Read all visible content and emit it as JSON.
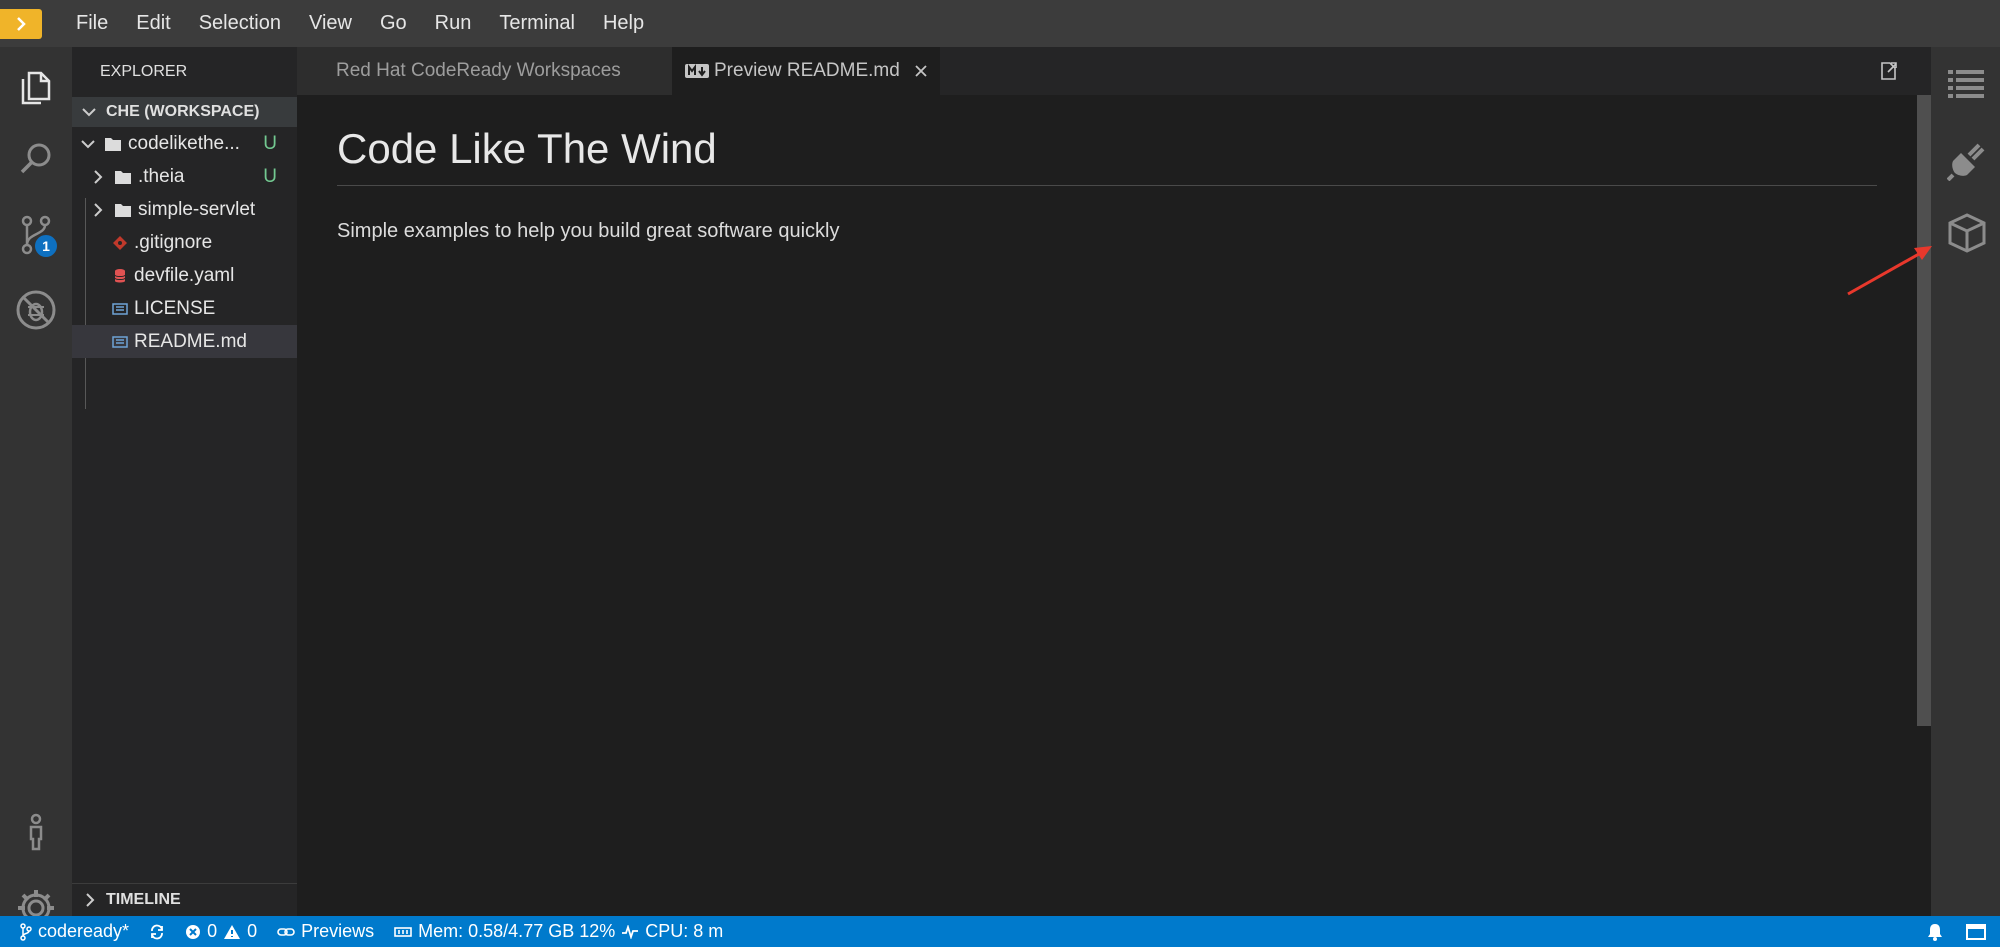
{
  "menu": {
    "items": [
      "File",
      "Edit",
      "Selection",
      "View",
      "Go",
      "Run",
      "Terminal",
      "Help"
    ]
  },
  "activity_bar": {
    "icons": [
      "explorer-icon",
      "search-icon",
      "source-control-icon",
      "debug-icon",
      "account-icon",
      "settings-icon"
    ],
    "scm_badge": "1"
  },
  "sidebar": {
    "title": "EXPLORER",
    "workspace": "CHE (WORKSPACE)",
    "tree": [
      {
        "label": "codelikethe...",
        "status": "U"
      },
      {
        "label": ".theia",
        "status": "U"
      },
      {
        "label": "simple-servlet",
        "status": ""
      },
      {
        "label": ".gitignore",
        "status": ""
      },
      {
        "label": "devfile.yaml",
        "status": ""
      },
      {
        "label": "LICENSE",
        "status": ""
      },
      {
        "label": "README.md",
        "status": ""
      }
    ],
    "timeline": "TIMELINE"
  },
  "tabs": [
    {
      "label": "Red Hat CodeReady Workspaces",
      "active": false
    },
    {
      "label": "Preview README.md",
      "active": true
    }
  ],
  "preview": {
    "heading": "Code Like The Wind",
    "text": "Simple examples to help you build great software quickly"
  },
  "right_panel": {
    "icons": [
      "outline-icon",
      "plugins-icon",
      "workspace-box-icon"
    ]
  },
  "statusbar": {
    "branch": "codeready*",
    "errors": "0",
    "warnings": "0",
    "previews": "Previews",
    "memory": "Mem: 0.58/4.77 GB 12%",
    "cpu": "CPU: 8 m"
  },
  "colors": {
    "accent": "#007acc",
    "logo": "#f0b429",
    "untracked": "#73c991",
    "annotation_arrow": "#e8382c"
  }
}
